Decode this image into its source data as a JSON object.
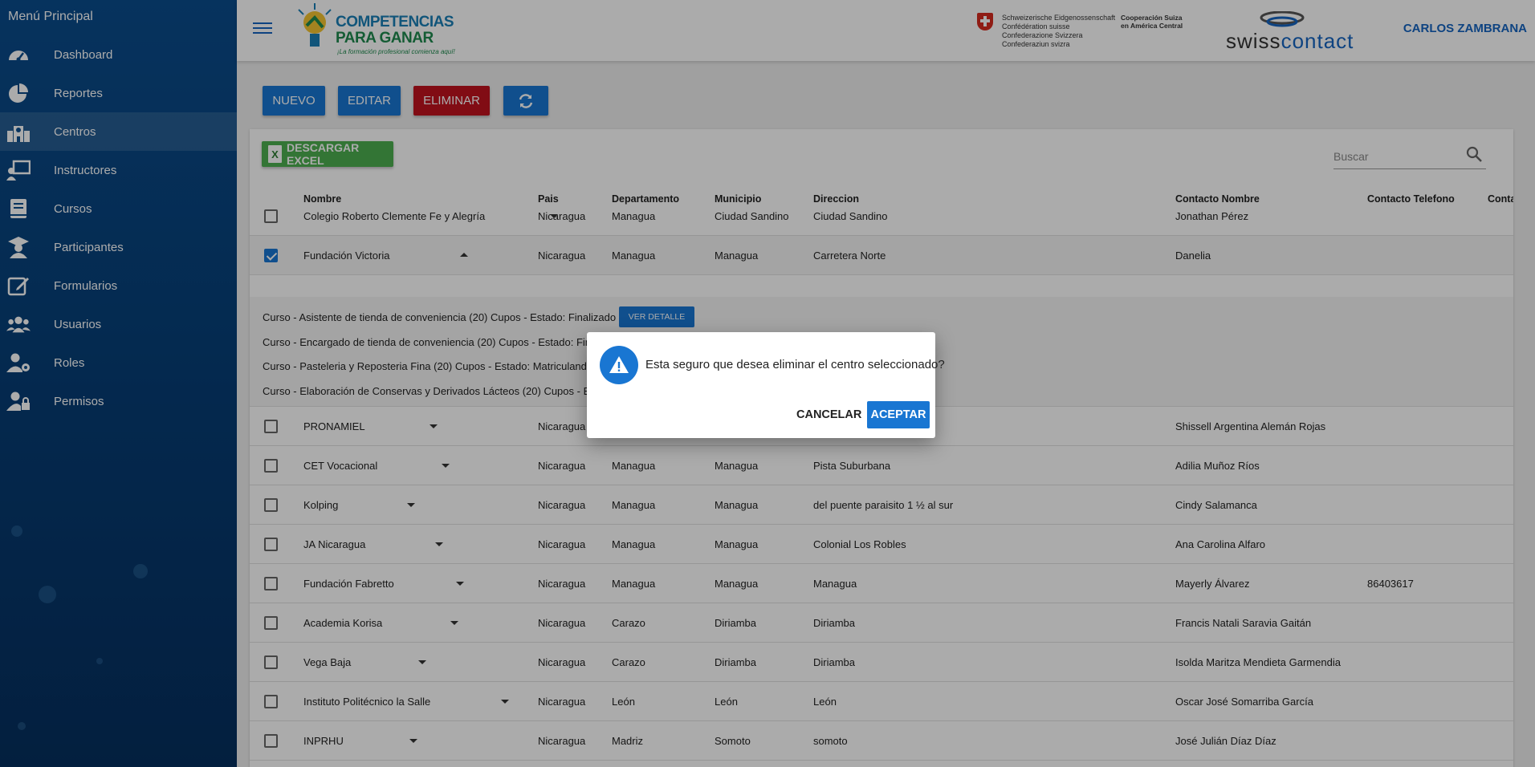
{
  "sidebar": {
    "title": "Menú Principal",
    "items": [
      {
        "label": "Dashboard",
        "icon": "dashboard-icon"
      },
      {
        "label": "Reportes",
        "icon": "pie-chart-icon"
      },
      {
        "label": "Centros",
        "icon": "school-icon",
        "active": true
      },
      {
        "label": "Instructores",
        "icon": "instructor-icon"
      },
      {
        "label": "Cursos",
        "icon": "book-icon"
      },
      {
        "label": "Participantes",
        "icon": "graduate-icon"
      },
      {
        "label": "Formularios",
        "icon": "edit-icon"
      },
      {
        "label": "Usuarios",
        "icon": "users-icon"
      },
      {
        "label": "Roles",
        "icon": "user-role-icon"
      },
      {
        "label": "Permisos",
        "icon": "user-lock-icon"
      }
    ]
  },
  "header": {
    "logo_line1": "COMPETENCIAS",
    "logo_line2": "PARA GANAR",
    "logo_sub": "¡La formación profesional comienza aquí!",
    "confed_lines": [
      "Schweizerische Eidgenossenschaft",
      "Confédération suisse",
      "Confederazione Svizzera",
      "Confederaziun svizra"
    ],
    "coop_lines": [
      "Cooperación Suiza",
      "en América Central"
    ],
    "sc_swiss": "swiss",
    "sc_contact": "contact",
    "user": "CARLOS ZAMBRANA"
  },
  "toolbar": {
    "nuevo": "NUEVO",
    "editar": "EDITAR",
    "eliminar": "ELIMINAR",
    "refresh_icon": "refresh-icon"
  },
  "table": {
    "excel_label": "DESCARGAR EXCEL",
    "excel_icon_letter": "X",
    "search_placeholder": "Buscar",
    "columns": {
      "nombre": "Nombre",
      "pais": "Pais",
      "departamento": "Departamento",
      "municipio": "Municipio",
      "direccion": "Direccion",
      "contacto_nombre": "Contacto Nombre",
      "contacto_telefono": "Contacto Telefono",
      "conta": "Conta"
    },
    "rows": [
      {
        "nombre": "Colegio Roberto Clemente Fe y Alegría",
        "pais": "Nicaragua",
        "depto": "Managua",
        "muni": "Ciudad Sandino",
        "dir": "Ciudad Sandino",
        "contacto": "Jonathan Pérez",
        "tel": ""
      },
      {
        "nombre": "Fundación Victoria",
        "pais": "Nicaragua",
        "depto": "Managua",
        "muni": "Managua",
        "dir": "Carretera Norte",
        "contacto": "Danelia",
        "tel": "",
        "selected": true
      },
      {
        "nombre": "PRONAMIEL",
        "pais": "Nicaragua",
        "depto": "",
        "muni": "",
        "dir": "",
        "contacto": "Shissell Argentina Alemán Rojas",
        "tel": ""
      },
      {
        "nombre": "CET Vocacional",
        "pais": "Nicaragua",
        "depto": "Managua",
        "muni": "Managua",
        "dir": "Pista Suburbana",
        "contacto": "Adilia Muñoz Ríos",
        "tel": ""
      },
      {
        "nombre": "Kolping",
        "pais": "Nicaragua",
        "depto": "Managua",
        "muni": "Managua",
        "dir": "del puente paraisito 1 ½ al sur",
        "contacto": "Cindy Salamanca",
        "tel": ""
      },
      {
        "nombre": "JA Nicaragua",
        "pais": "Nicaragua",
        "depto": "Managua",
        "muni": "Managua",
        "dir": "Colonial Los Robles",
        "contacto": "Ana Carolina Alfaro",
        "tel": ""
      },
      {
        "nombre": "Fundación Fabretto",
        "pais": "Nicaragua",
        "depto": "Managua",
        "muni": "Managua",
        "dir": "Managua",
        "contacto": "Mayerly Álvarez",
        "tel": "86403617"
      },
      {
        "nombre": "Academia Korisa",
        "pais": "Nicaragua",
        "depto": "Carazo",
        "muni": "Diriamba",
        "dir": "Diriamba",
        "contacto": "Francis Natali Saravia Gaitán",
        "tel": ""
      },
      {
        "nombre": "Vega Baja",
        "pais": "Nicaragua",
        "depto": "Carazo",
        "muni": "Diriamba",
        "dir": "Diriamba",
        "contacto": "Isolda Maritza Mendieta Garmendia",
        "tel": ""
      },
      {
        "nombre": "Instituto Politécnico la Salle",
        "pais": "Nicaragua",
        "depto": "León",
        "muni": "León",
        "dir": "León",
        "contacto": "Oscar José Somarriba García",
        "tel": ""
      },
      {
        "nombre": "INPRHU",
        "pais": "Nicaragua",
        "depto": "Madriz",
        "muni": "Somoto",
        "dir": "somoto",
        "contacto": "José Julián Díaz Díaz",
        "tel": ""
      }
    ],
    "detail": {
      "lines": [
        "Curso - Asistente de tienda de conveniencia (20) Cupos - Estado: Finalizado",
        "Curso - Encargado de tienda de conveniencia (20) Cupos - Estado: Fina",
        "Curso - Pasteleria y Reposteria Fina (20) Cupos - Estado: Matriculando",
        "Curso - Elaboración de Conservas y Derivados Lácteos (20) Cupos - Es"
      ],
      "ver_detalle": "VER DETALLE"
    }
  },
  "dialog": {
    "message": "Esta seguro que desea eliminar el centro seleccionado?",
    "cancel": "CANCELAR",
    "accept": "ACEPTAR",
    "icon": "warning-icon"
  }
}
